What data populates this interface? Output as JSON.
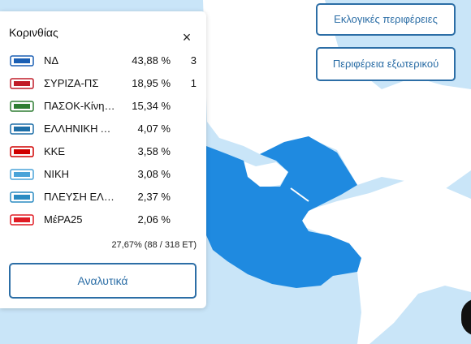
{
  "panel": {
    "title": "Κορινθίας",
    "close_label": "×",
    "turnout": "27,67% (88 / 318 ΕΤ)",
    "analysis_button": "Αναλυτικά"
  },
  "parties": [
    {
      "name": "ΝΔ",
      "pct": "43,88 %",
      "seats": "3",
      "logo": "nd-logo",
      "color": "#1a5fb4"
    },
    {
      "name": "ΣΥΡΙΖΑ-ΠΣ",
      "pct": "18,95 %",
      "seats": "1",
      "logo": "syriza-logo",
      "color": "#c01c28"
    },
    {
      "name": "ΠΑΣΟΚ-Κίνημα Αλλαγής",
      "pct": "15,34 %",
      "seats": "",
      "logo": "pasok-logo",
      "color": "#2e7d32"
    },
    {
      "name": "ΕΛΛΗΝΙΚΗ ΛΥΣΗ",
      "pct": "4,07 %",
      "seats": "",
      "logo": "elliniki-lysi-logo",
      "color": "#1e6fa8"
    },
    {
      "name": "ΚΚΕ",
      "pct": "3,58 %",
      "seats": "",
      "logo": "kke-logo",
      "color": "#d00000"
    },
    {
      "name": "ΝΙΚΗ",
      "pct": "3,08 %",
      "seats": "",
      "logo": "niki-logo",
      "color": "#4aa3d8"
    },
    {
      "name": "ΠΛΕΥΣΗ ΕΛΕΥΘΕΡΙΑΣ",
      "pct": "2,37 %",
      "seats": "",
      "logo": "plefsi-logo",
      "color": "#2a8bc2"
    },
    {
      "name": "ΜέΡΑ25",
      "pct": "2,06 %",
      "seats": "",
      "logo": "mera25-logo",
      "color": "#e01b24"
    }
  ],
  "buttons": {
    "regions": "Εκλογικές περιφέρειες",
    "abroad": "Περιφέρεια εξωτερικού"
  },
  "colors": {
    "sea": "#c9e5f8",
    "land": "#ffffff",
    "highlight": "#1f8ae0",
    "accent": "#2c6ea6"
  }
}
